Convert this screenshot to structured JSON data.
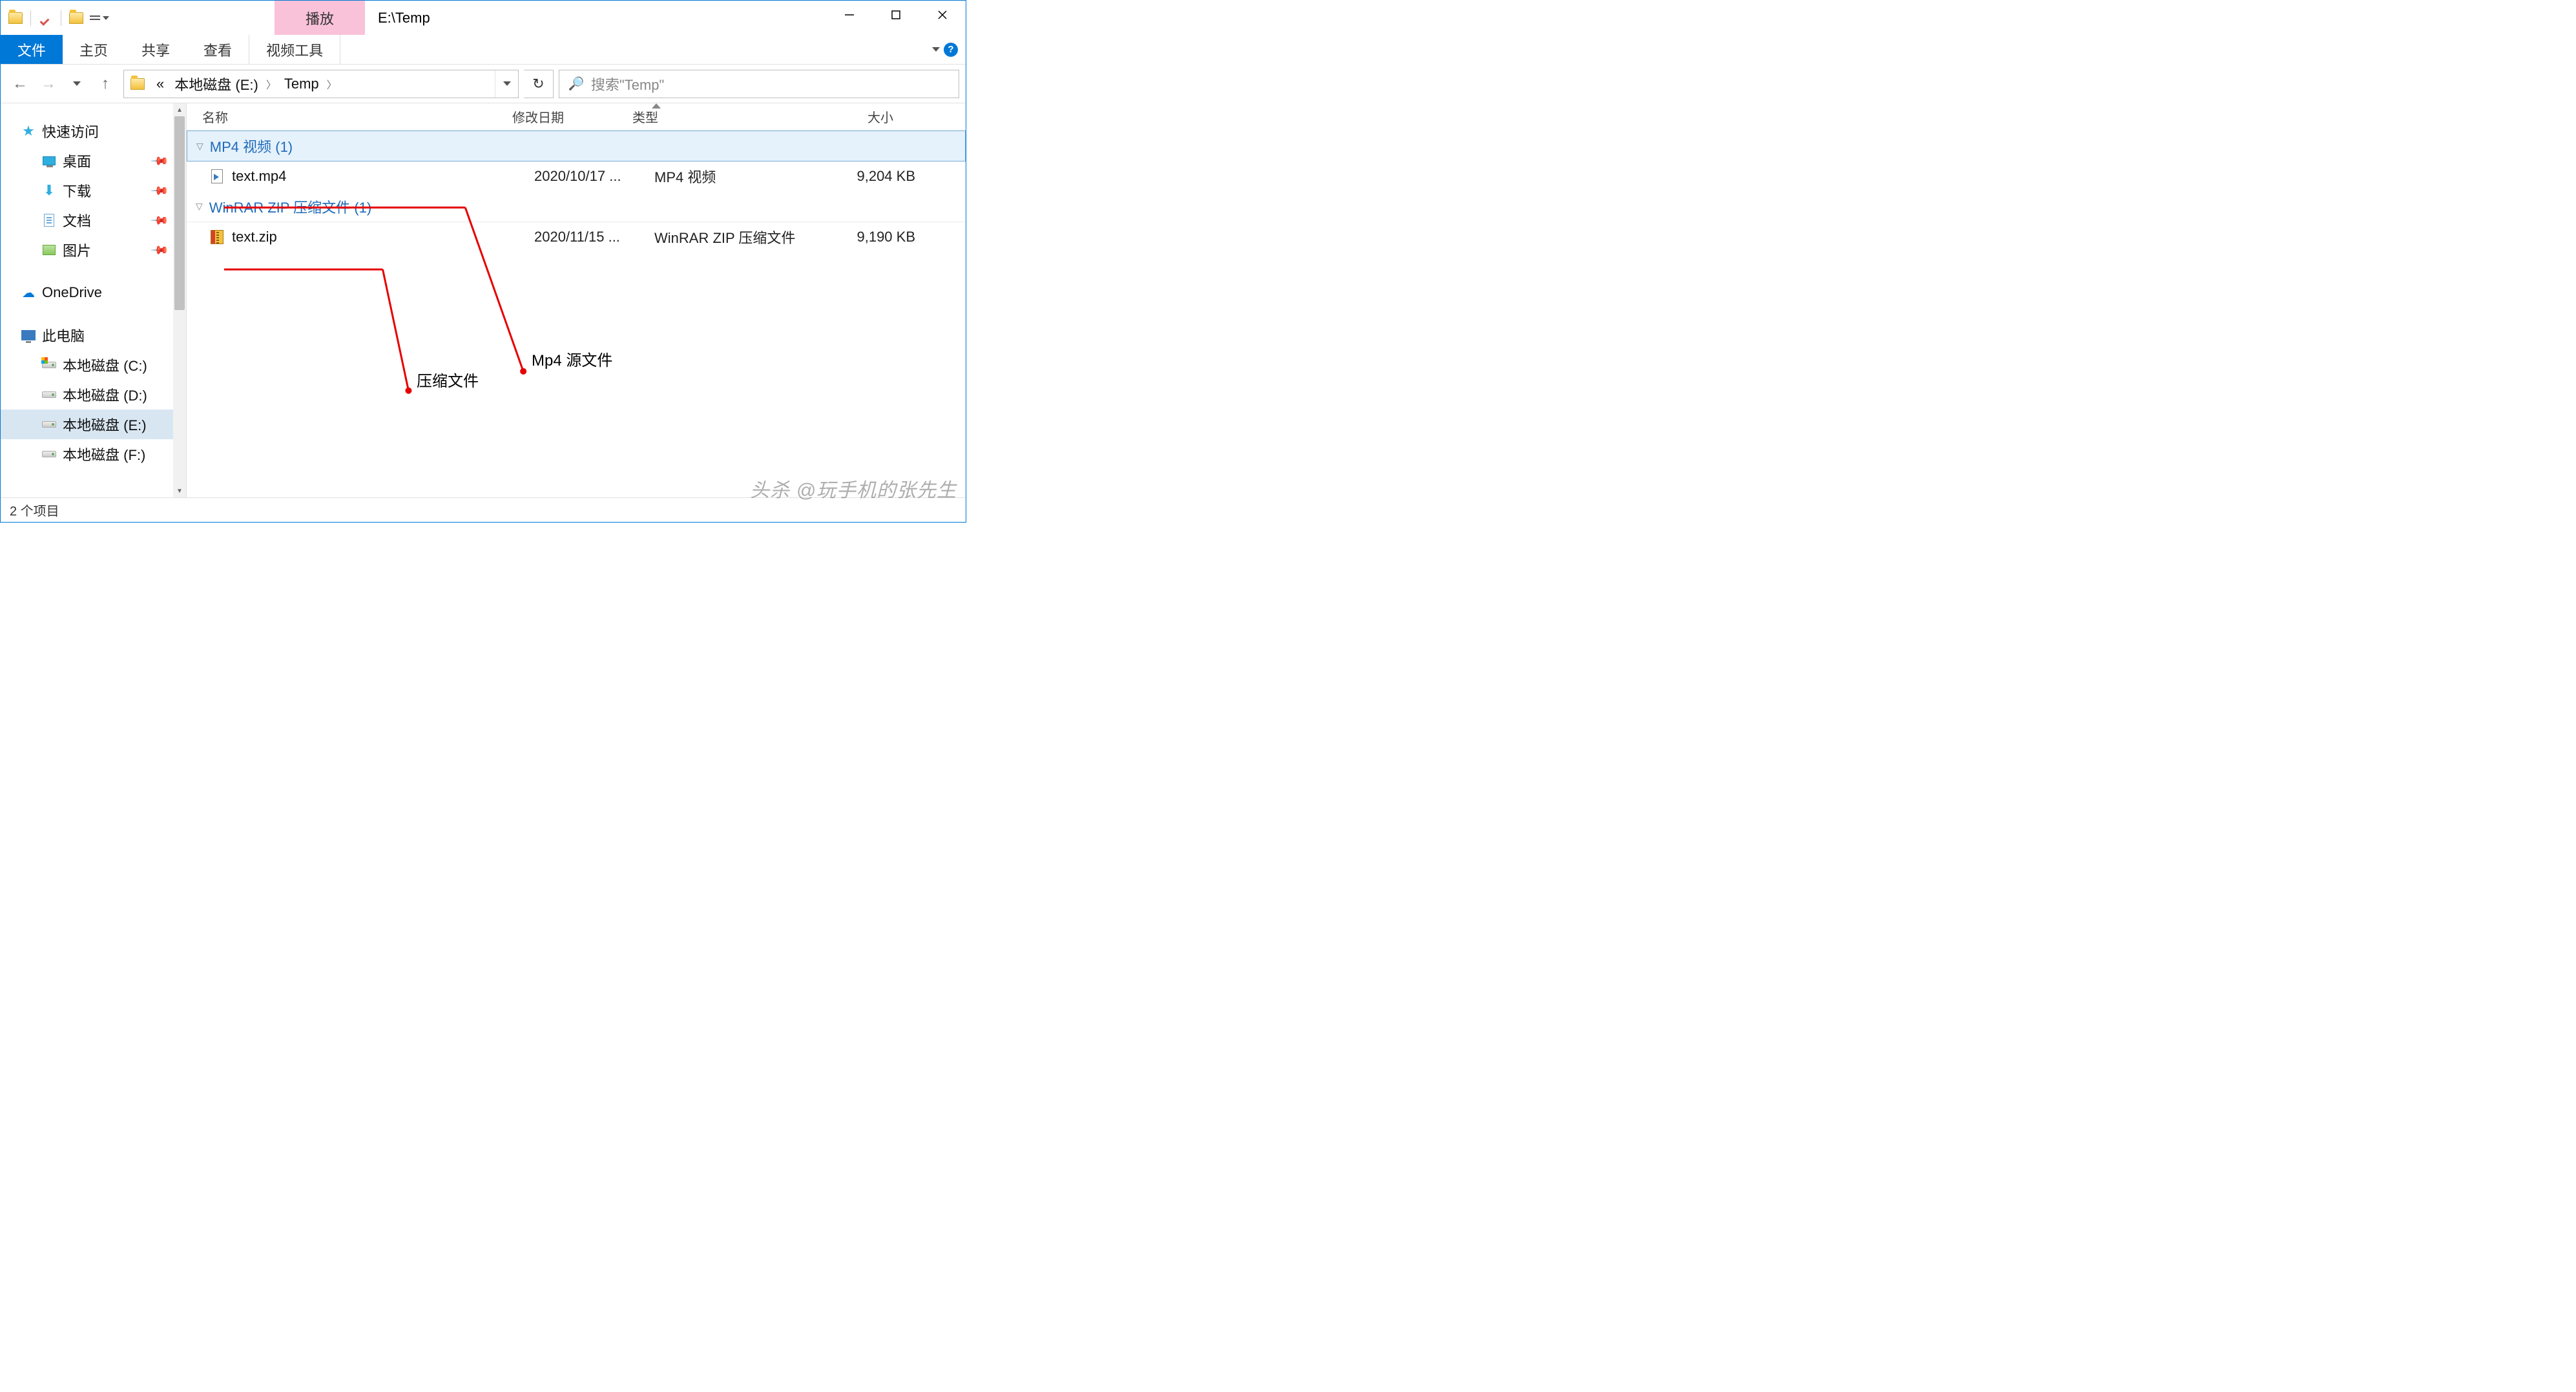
{
  "title": "E:\\Temp",
  "context_tab_header": "播放",
  "ribbon": {
    "file": "文件",
    "home": "主页",
    "share": "共享",
    "view": "查看",
    "context": "视频工具"
  },
  "breadcrumb": {
    "prefix": "«",
    "drive": "本地磁盘 (E:)",
    "folder": "Temp"
  },
  "search_placeholder": "搜索\"Temp\"",
  "columns": {
    "name": "名称",
    "date": "修改日期",
    "type": "类型",
    "size": "大小"
  },
  "nav": {
    "quick_access": "快速访问",
    "desktop": "桌面",
    "downloads": "下载",
    "documents": "文档",
    "pictures": "图片",
    "onedrive": "OneDrive",
    "this_pc": "此电脑",
    "drive_c": "本地磁盘 (C:)",
    "drive_d": "本地磁盘 (D:)",
    "drive_e": "本地磁盘 (E:)",
    "drive_f": "本地磁盘 (F:)"
  },
  "groups": [
    {
      "header": "MP4 视频 (1)",
      "files": [
        {
          "name": "text.mp4",
          "date": "2020/10/17 ...",
          "type": "MP4 视频",
          "size": "9,204 KB",
          "icon": "mp4"
        }
      ]
    },
    {
      "header": "WinRAR ZIP 压缩文件 (1)",
      "files": [
        {
          "name": "text.zip",
          "date": "2020/11/15 ...",
          "type": "WinRAR ZIP 压缩文件",
          "size": "9,190 KB",
          "icon": "zip"
        }
      ]
    }
  ],
  "annotations": {
    "mp4_label": "Mp4 源文件",
    "zip_label": "压缩文件"
  },
  "status": "2 个项目",
  "watermark": "头杀 @玩手机的张先生"
}
